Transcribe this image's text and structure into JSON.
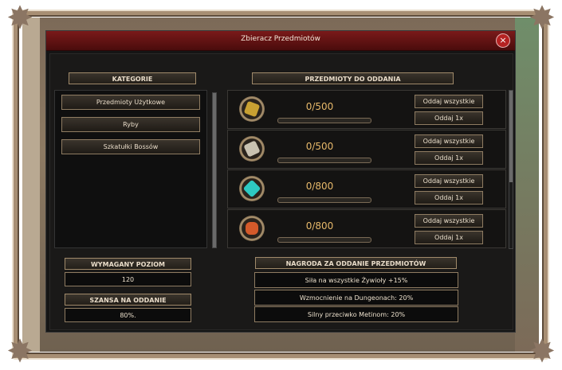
{
  "window": {
    "title": "Zbieracz Przedmiotów",
    "close_glyph": "×"
  },
  "categories": {
    "header": "KATEGORIE",
    "items": [
      {
        "label": "Przedmioty Użytkowe"
      },
      {
        "label": "Ryby"
      },
      {
        "label": "Szkatułki Bossów"
      }
    ]
  },
  "items_panel": {
    "header": "PRZEDMIOTY DO ODDANIA",
    "rows": [
      {
        "icon": "armor-piece-icon",
        "color": "#c8a032",
        "count": "0/500",
        "progress": 0,
        "give_all": "Oddaj wszystkie",
        "give_one": "Oddaj 1x"
      },
      {
        "icon": "scroll-icon",
        "color": "#c9c2b1",
        "count": "0/500",
        "progress": 0,
        "give_all": "Oddaj wszystkie",
        "give_one": "Oddaj 1x"
      },
      {
        "icon": "cyan-crystal-icon",
        "color": "#2ec9c2",
        "count": "0/800",
        "progress": 0,
        "give_all": "Oddaj wszystkie",
        "give_one": "Oddaj 1x"
      },
      {
        "icon": "red-ore-icon",
        "color": "#d45a2a",
        "count": "0/800",
        "progress": 0,
        "give_all": "Oddaj wszystkie",
        "give_one": "Oddaj 1x"
      }
    ]
  },
  "required_level": {
    "header": "WYMAGANY POZIOM",
    "value": "120"
  },
  "chance": {
    "header": "SZANSA NA ODDANIE",
    "value": "80%."
  },
  "reward": {
    "header": "NAGRODA ZA ODDANIE PRZEDMIOTÓW",
    "lines": [
      "Siła na wszystkie Żywioły +15%",
      "Wzmocnienie na Dungeonach: 20%",
      "Silny przeciwko Metinom: 20%"
    ]
  },
  "colors": {
    "title_bar": "#7a1a1a",
    "accent_gold": "#e8b96a"
  }
}
